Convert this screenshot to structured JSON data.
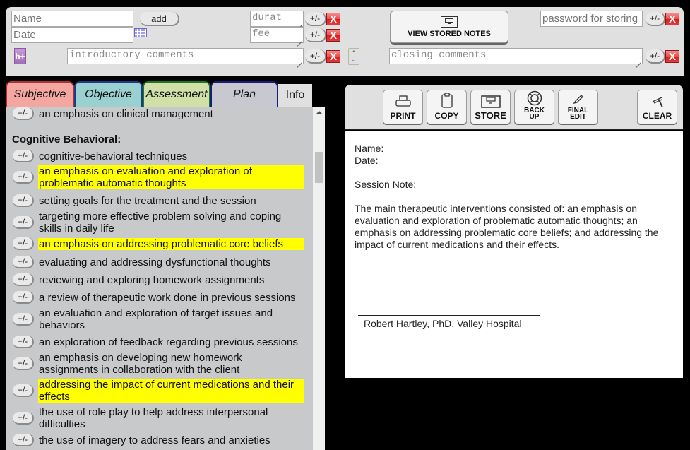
{
  "header": {
    "name_placeholder": "Name",
    "date_placeholder": "Date",
    "add_label": "add",
    "duration_placeholder": "durat",
    "fee_placeholder": "fee",
    "intro_placeholder": "introductory comments",
    "closing_placeholder": "closing comments",
    "password_placeholder": "password for storing",
    "toggle_label": "+/-",
    "remove_label": "X",
    "view_stored_label": "VIEW STORED NOTES",
    "hplus_label": "h+"
  },
  "tabs": [
    {
      "label": "Subjective",
      "color": "#f4a6a0"
    },
    {
      "label": "Objective",
      "color": "#9ad0d0"
    },
    {
      "label": "Assessment",
      "color": "#d0e0a8"
    },
    {
      "label": "Plan",
      "color": "#c8c8d0"
    },
    {
      "label": "Info",
      "color": "#e0e0e0"
    }
  ],
  "list": {
    "toggle_label": "+/-",
    "top_item": "an emphasis on clinical management",
    "section_title": "Cognitive Behavioral:",
    "items": [
      {
        "text": "cognitive-behavioral techniques",
        "highlighted": false
      },
      {
        "text": "an emphasis on evaluation and exploration of problematic automatic thoughts",
        "highlighted": true
      },
      {
        "text": "setting goals for the treatment and the session",
        "highlighted": false
      },
      {
        "text": "targeting more effective problem solving and coping skills in daily life",
        "highlighted": false
      },
      {
        "text": "an emphasis on addressing problematic core beliefs",
        "highlighted": true
      },
      {
        "text": "evaluating and addressing dysfunctional thoughts",
        "highlighted": false
      },
      {
        "text": "reviewing and exploring homework assignments",
        "highlighted": false
      },
      {
        "text": "a review of therapeutic work done in previous sessions",
        "highlighted": false
      },
      {
        "text": "an evaluation and exploration of target issues and behaviors",
        "highlighted": false
      },
      {
        "text": "an exploration of feedback regarding previous sessions",
        "highlighted": false
      },
      {
        "text": "an emphasis on developing new homework assignments in collaboration with the client",
        "highlighted": false
      },
      {
        "text": "addressing the impact of current medications and their effects",
        "highlighted": true
      },
      {
        "text": "the use of role play to help address interpersonal difficulties",
        "highlighted": false
      },
      {
        "text": "the use of imagery to address fears and anxieties",
        "highlighted": false
      }
    ],
    "highlight_color": "#ffff00"
  },
  "toolbar": {
    "print": "PRINT",
    "copy": "COPY",
    "store": "STORE",
    "backup_line1": "BACK",
    "backup_line2": "UP",
    "final_line1": "FINAL",
    "final_line2": "EDIT",
    "clear": "CLEAR"
  },
  "note": {
    "name_line": "Name:",
    "date_line": "Date:",
    "session_label": "Session Note:",
    "body": "The main therapeutic interventions consisted of: an emphasis on evaluation and exploration of problematic automatic thoughts; an emphasis on addressing problematic core beliefs; and addressing the impact of current medications and their effects.",
    "signature": "Robert Hartley, PhD, Valley Hospital"
  }
}
